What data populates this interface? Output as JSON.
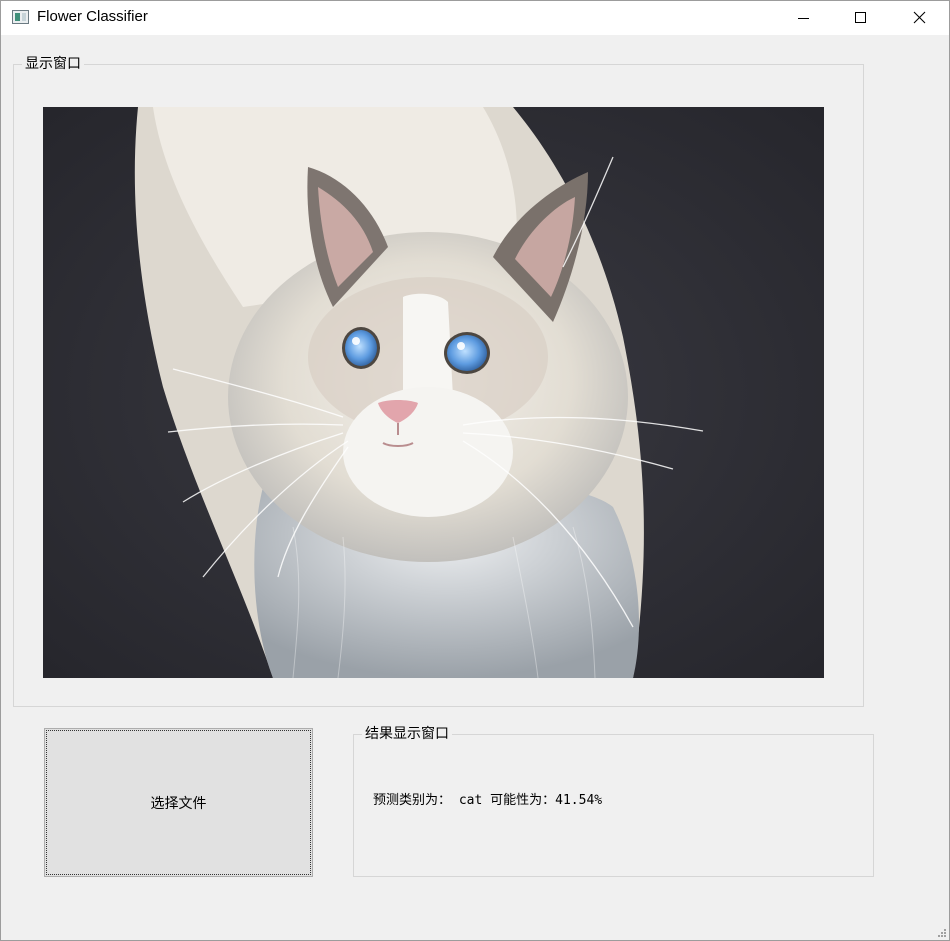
{
  "window": {
    "title": "Flower Classifier",
    "controls": [
      "minimize-icon",
      "maximize-icon",
      "close-icon"
    ]
  },
  "display_group": {
    "title": "显示窗口",
    "image": {
      "description_icon": "cat-photo",
      "background_color": "#2d2d33"
    }
  },
  "select_button": {
    "label": "选择文件"
  },
  "result_group": {
    "title": "结果显示窗口",
    "text": "预测类别为： cat 可能性为：41.54%"
  }
}
